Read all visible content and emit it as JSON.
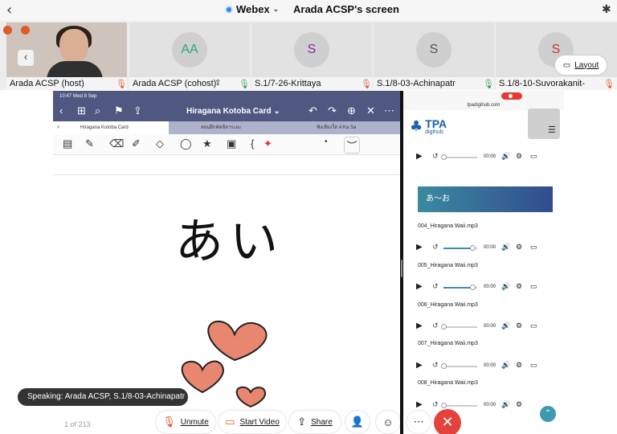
{
  "topbar": {
    "back_glyph": "‹",
    "app_name": "Webex",
    "app_chevron": "⌄",
    "screen_title": "Arada ACSP's screen",
    "bluetooth_glyph": "✱"
  },
  "participants": [
    {
      "name": "Arada ACSP (host)",
      "mic_glyph": "🎙",
      "mic_color": "#e0582b"
    },
    {
      "name": "Arada ACSP (cohost)",
      "initials": "AA",
      "initials_color": "#2fa38a",
      "mic_glyph": "🎙",
      "mic_color": "#2e9e4a"
    },
    {
      "name": "S.1/7-26-Krittaya",
      "initials": "S",
      "initials_color": "#8a2ca8",
      "mic_glyph": "🎙",
      "mic_color": "#e0582b"
    },
    {
      "name": "S.1/8-03-Achinapatr",
      "initials": "S",
      "initials_color": "#555555",
      "mic_glyph": "🎙",
      "mic_color": "#2e9e4a"
    },
    {
      "name": "S.1/8-10-Suvorakanit-",
      "initials": "S",
      "initials_color": "#c0392b",
      "mic_glyph": "🎙",
      "mic_color": "#e0582b"
    }
  ],
  "video": {
    "left_btn_glyph": "‹"
  },
  "layout_button": {
    "icon": "▭",
    "label": "Layout"
  },
  "goodnotes": {
    "status_time": "10:47  Wed 8 Sep",
    "title": "Hiragana Kotoba Card ⌄",
    "tabs": [
      "Hiragana Kotoba Card",
      "สอนฝึกคัดลีลาระยะ",
      "ฟังเสียงใส A Ka Sa"
    ],
    "toolbar_icons": {
      "back": "‹",
      "grid": "⊞",
      "search": "⌕",
      "bookmark": "⚑",
      "share": "⇪",
      "undo": "↶",
      "redo": "↷",
      "add": "⊕",
      "close": "✕",
      "more": "⋯"
    },
    "tool_icons": {
      "reader": "▤",
      "pen": "✎",
      "eraser": "⌫",
      "highlighter": "✐",
      "shapes": "◇",
      "lasso": "◯",
      "sticker": "★",
      "image": "▣",
      "text": "{",
      "laser": "✦",
      "dot": "•",
      "line": "︶"
    },
    "kana": "あい",
    "page_count": "1 of 213"
  },
  "safari": {
    "url": "tpadigihub.com",
    "logo_mark": "♣",
    "logo_text": "TPA",
    "logo_sub": "digihub",
    "menu_glyph": "☰",
    "section_title": "あ～お",
    "player_icons": {
      "play": "▶",
      "replay": "↺",
      "volume": "🔊",
      "settings": "⚙",
      "cast": "▭"
    },
    "time": "00:00",
    "files": [
      "004_Hiragana Waii.mp3",
      "005_Hiragana Waii.mp3",
      "006_Hiragana Waii.mp3",
      "007_Hiragana Waii.mp3",
      "008_Hiragana Waii.mp3"
    ],
    "scroll_top_glyph": "⌃"
  },
  "controls": {
    "speaking": "Speaking: Arada ACSP, S.1/8-03-Achinapatr",
    "unmute": "Unmute",
    "unmute_icon": "🎙",
    "start_video": "Start Video",
    "video_icon": "▭",
    "share": "Share",
    "share_icon": "⇪",
    "participants_icon": "👤",
    "reactions_icon": "☺",
    "more_icon": "⋯",
    "end_icon": "✕"
  }
}
